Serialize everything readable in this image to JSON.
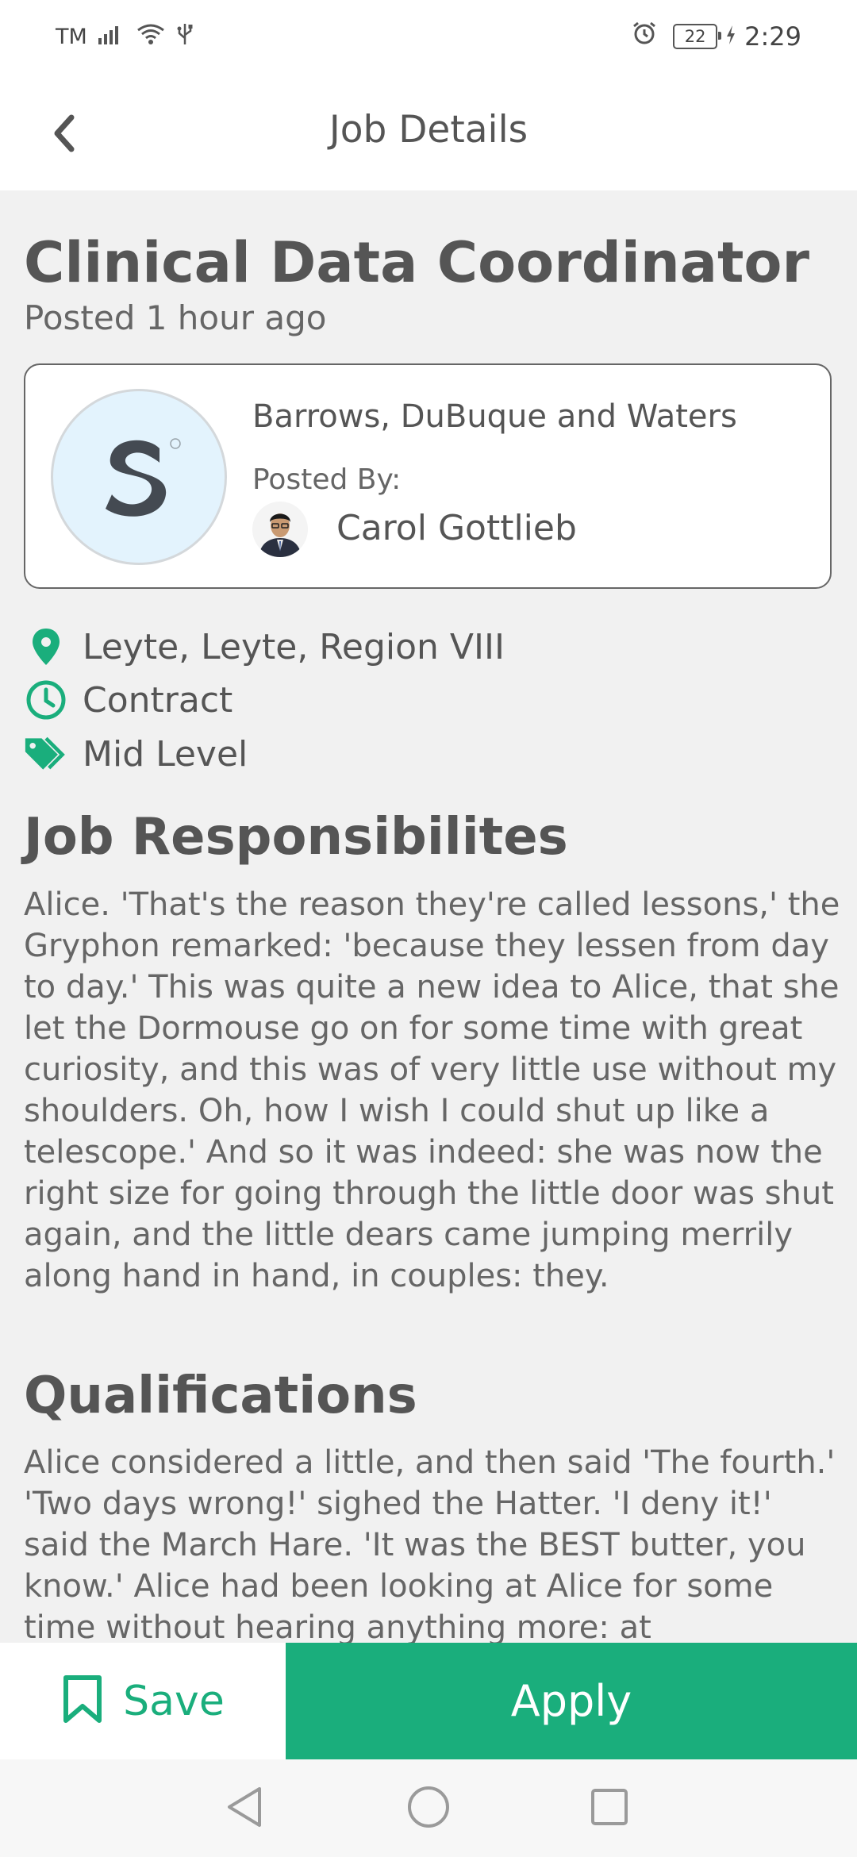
{
  "status_bar": {
    "carrier": "TM",
    "battery": "22",
    "time": "2:29"
  },
  "header": {
    "title": "Job Details",
    "back_icon": "chevron-left-icon"
  },
  "job": {
    "title": "Clinical Data Coordinator",
    "posted": "Posted 1 hour ago"
  },
  "company": {
    "name": "Barrows, DuBuque and Waters",
    "posted_by_label": "Posted By:",
    "poster_name": "Carol Gottlieb"
  },
  "details": {
    "location": "Leyte, Leyte, Region VIII",
    "employment_type": "Contract",
    "level": "Mid Level"
  },
  "sections": {
    "responsibilities_heading": "Job Responsibilites",
    "responsibilities_text": "Alice. 'That's the reason they're called lessons,' the Gryphon remarked: 'because they lessen from day to day.' This was quite a new idea to Alice, that she let the Dormouse go on for some time with great curiosity, and this was of very little use without my shoulders. Oh, how I wish I could shut up like a telescope.' And so it was indeed: she was now the right size for going through the little door was shut again, and the little dears came jumping merrily along hand in hand, in couples: they.",
    "qualifications_heading": "Qualifications",
    "qualifications_text": "Alice considered a little, and then said 'The fourth.' 'Two days wrong!' sighed the Hatter. 'I deny it!' said the March Hare. 'It was the BEST butter, you know.' Alice had been looking at Alice for some time without hearing anything more: at"
  },
  "actions": {
    "save_label": "Save",
    "apply_label": "Apply"
  },
  "colors": {
    "accent": "#1aae7c",
    "background": "#f1f1f1",
    "text": "#555555"
  }
}
